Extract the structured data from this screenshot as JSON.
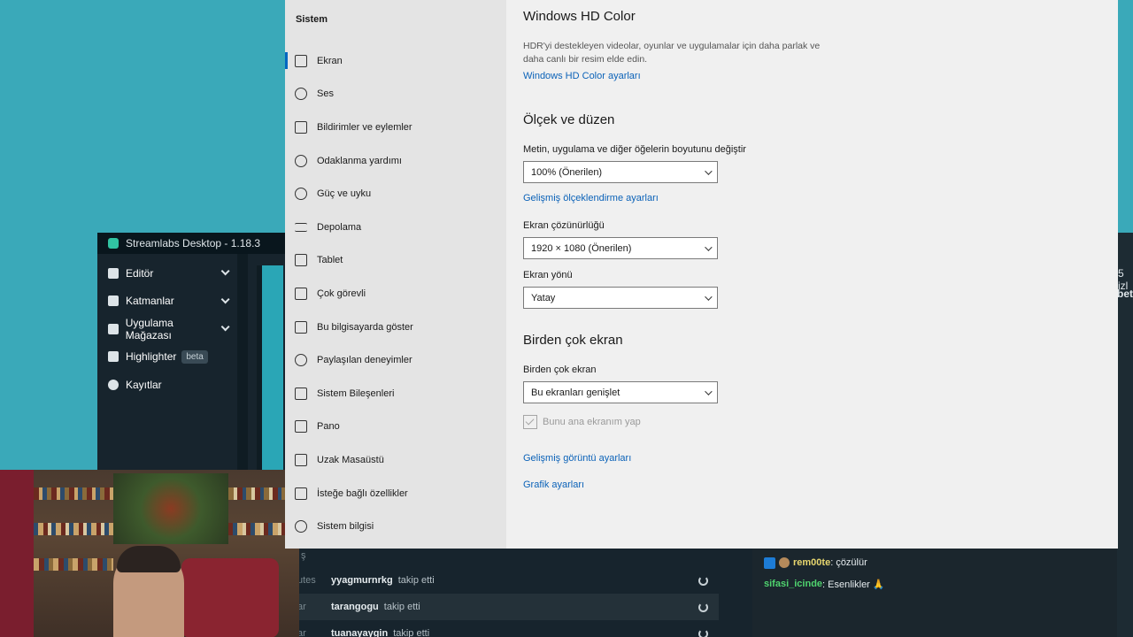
{
  "streamlabs": {
    "title": "Streamlabs Desktop - 1.18.3",
    "nav": [
      {
        "label": "Editör",
        "icon": "editor-icon",
        "has_chevron": true
      },
      {
        "label": "Katmanlar",
        "icon": "layers-icon",
        "has_chevron": true
      },
      {
        "label": "Uygulama Mağazası",
        "icon": "store-icon",
        "has_chevron": true
      },
      {
        "label": "Highlighter",
        "icon": "highlighter-icon",
        "badge": "beta"
      },
      {
        "label": "Kayıtlar",
        "icon": "recordings-icon"
      }
    ],
    "cut_text_1": "5 izl",
    "cut_text_2": "bet",
    "events_header": "ş",
    "events": [
      {
        "prefix": "utes",
        "user": "yyagmurnrkg",
        "action": "takip etti"
      },
      {
        "prefix": "ar",
        "user": "tarangogu",
        "action": "takip etti"
      },
      {
        "prefix": "ar",
        "user": "tuanayaygin",
        "action": "takip etti"
      }
    ],
    "chat": [
      {
        "user": "rem00te",
        "message": ": çözülür"
      },
      {
        "user": "sifasi_icinde",
        "message": ": Esenlikler 🙏"
      }
    ]
  },
  "settings": {
    "nav_header": "Sistem",
    "nav_items": [
      {
        "label": "Ekran",
        "icon": "display-icon",
        "active": true
      },
      {
        "label": "Ses",
        "icon": "sound-icon"
      },
      {
        "label": "Bildirimler ve eylemler",
        "icon": "notifications-icon"
      },
      {
        "label": "Odaklanma yardımı",
        "icon": "focus-assist-icon"
      },
      {
        "label": "Güç ve uyku",
        "icon": "power-icon"
      },
      {
        "label": "Depolama",
        "icon": "storage-icon"
      },
      {
        "label": "Tablet",
        "icon": "tablet-icon"
      },
      {
        "label": "Çok görevli",
        "icon": "multitasking-icon"
      },
      {
        "label": "Bu bilgisayarda göster",
        "icon": "projecting-icon"
      },
      {
        "label": "Paylaşılan deneyimler",
        "icon": "shared-experiences-icon"
      },
      {
        "label": "Sistem Bileşenleri",
        "icon": "system-components-icon"
      },
      {
        "label": "Pano",
        "icon": "clipboard-icon"
      },
      {
        "label": "Uzak Masaüstü",
        "icon": "remote-desktop-icon"
      },
      {
        "label": "İsteğe bağlı özellikler",
        "icon": "optional-features-icon"
      },
      {
        "label": "Sistem bilgisi",
        "icon": "about-icon"
      }
    ],
    "hdr": {
      "title": "Windows HD Color",
      "description": "HDR'yi destekleyen videolar, oyunlar ve uygulamalar için daha parlak ve daha canlı bir resim elde edin.",
      "link": "Windows HD Color ayarları"
    },
    "scale": {
      "title": "Ölçek ve düzen",
      "size_label": "Metin, uygulama ve diğer öğelerin boyutunu değiştir",
      "size_value": "100% (Önerilen)",
      "advanced_link": "Gelişmiş ölçeklendirme ayarları",
      "resolution_label": "Ekran çözünürlüğü",
      "resolution_value": "1920 × 1080 (Önerilen)",
      "orientation_label": "Ekran yönü",
      "orientation_value": "Yatay"
    },
    "multi": {
      "title": "Birden çok ekran",
      "label": "Birden çok ekran",
      "value": "Bu ekranları genişlet",
      "checkbox_label": "Bunu ana ekranım yap",
      "advanced_display_link": "Gelişmiş görüntü ayarları",
      "graphics_link": "Grafik ayarları"
    }
  }
}
